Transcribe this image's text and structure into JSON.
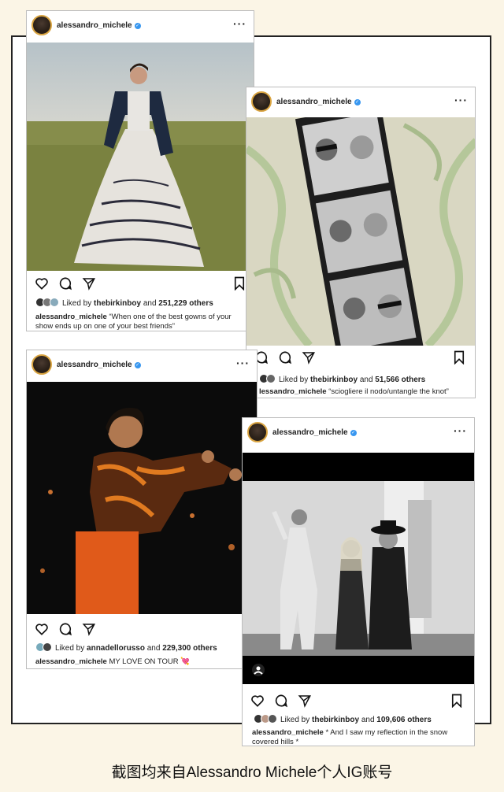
{
  "posts": [
    {
      "username": "alessandro_michele",
      "liked_by": "thebirkinboy",
      "likes_count": "251,229 others",
      "caption_user": "alessandro_michele",
      "caption_text": "“When one of the best gowns of your show ends up on one of your best friends”"
    },
    {
      "username": "alessandro_michele",
      "liked_by": "thebirkinboy",
      "likes_count": "51,566 others",
      "caption_user": "lessandro_michele",
      "caption_text": "“sciogliere il nodo/untangle the knot”"
    },
    {
      "username": "alessandro_michele",
      "liked_by": "annadellorusso",
      "likes_count": "229,300 others",
      "caption_user": "alessandro_michele",
      "caption_text": "MY LOVE ON TOUR 💘"
    },
    {
      "username": "alessandro_michele",
      "liked_by": "thebirkinboy",
      "likes_count": "109,606 others",
      "caption_user": "alessandro_michele",
      "caption_text": "* And I saw my reflection in the snow covered hills *"
    }
  ],
  "labels": {
    "liked_by": "Liked by",
    "and": "and"
  },
  "footer": "截图均来自Alessandro Michele个人IG账号",
  "colors": {
    "background": "#fbf5e6",
    "verified": "#3897f0"
  }
}
